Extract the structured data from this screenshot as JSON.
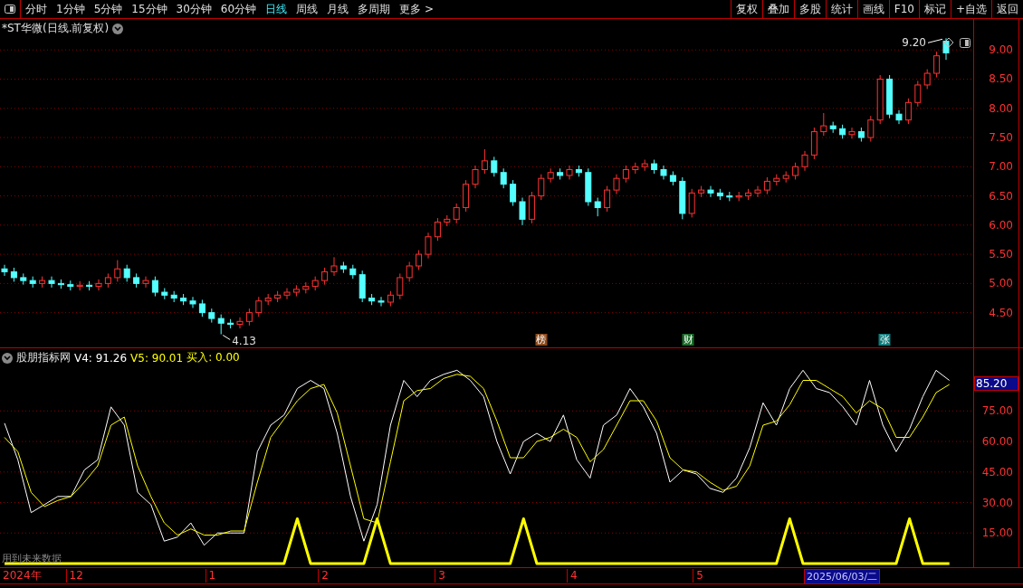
{
  "toolbar": {
    "periods": [
      {
        "label": "分时",
        "selected": false
      },
      {
        "label": "1分钟",
        "selected": false
      },
      {
        "label": "5分钟",
        "selected": false
      },
      {
        "label": "15分钟",
        "selected": false
      },
      {
        "label": "30分钟",
        "selected": false
      },
      {
        "label": "60分钟",
        "selected": false
      },
      {
        "label": "日线",
        "selected": true
      },
      {
        "label": "周线",
        "selected": false
      },
      {
        "label": "月线",
        "selected": false
      },
      {
        "label": "多周期",
        "selected": false
      },
      {
        "label": "更多 >",
        "selected": false
      }
    ],
    "actions": [
      "复权",
      "叠加",
      "多股",
      "统计",
      "画线",
      "F10",
      "标记",
      "+自选",
      "返回"
    ]
  },
  "price_pane": {
    "title": "*ST华微(日线.前复权)",
    "chart_data": {
      "type": "candlestick",
      "grid": true,
      "ohlc": [
        [
          5.25,
          5.32,
          5.13,
          5.2
        ],
        [
          5.2,
          5.27,
          5.03,
          5.1
        ],
        [
          5.1,
          5.17,
          4.98,
          5.05
        ],
        [
          5.05,
          5.12,
          4.93,
          5.0
        ],
        [
          5.0,
          5.12,
          4.93,
          5.05
        ],
        [
          5.05,
          5.12,
          4.93,
          5.0
        ],
        [
          5.0,
          5.07,
          4.91,
          4.98
        ],
        [
          4.98,
          5.05,
          4.88,
          4.95
        ],
        [
          4.95,
          5.04,
          4.88,
          4.97
        ],
        [
          4.97,
          5.04,
          4.88,
          4.95
        ],
        [
          4.95,
          5.07,
          4.88,
          5.0
        ],
        [
          5.0,
          5.17,
          4.93,
          5.1
        ],
        [
          5.1,
          5.4,
          5.03,
          5.25
        ],
        [
          5.25,
          5.32,
          5.03,
          5.1
        ],
        [
          5.1,
          5.17,
          4.93,
          5.0
        ],
        [
          5.0,
          5.12,
          4.93,
          5.05
        ],
        [
          5.05,
          5.12,
          4.78,
          4.85
        ],
        [
          4.85,
          4.92,
          4.73,
          4.8
        ],
        [
          4.8,
          4.87,
          4.68,
          4.75
        ],
        [
          4.75,
          4.82,
          4.63,
          4.7
        ],
        [
          4.7,
          4.77,
          4.58,
          4.65
        ],
        [
          4.65,
          4.72,
          4.43,
          4.5
        ],
        [
          4.5,
          4.57,
          4.33,
          4.4
        ],
        [
          4.4,
          4.47,
          4.13,
          4.32
        ],
        [
          4.32,
          4.39,
          4.23,
          4.3
        ],
        [
          4.3,
          4.42,
          4.23,
          4.35
        ],
        [
          4.35,
          4.57,
          4.28,
          4.5
        ],
        [
          4.5,
          4.77,
          4.43,
          4.7
        ],
        [
          4.7,
          4.82,
          4.63,
          4.75
        ],
        [
          4.75,
          4.87,
          4.68,
          4.8
        ],
        [
          4.8,
          4.92,
          4.73,
          4.85
        ],
        [
          4.85,
          4.97,
          4.78,
          4.9
        ],
        [
          4.9,
          5.02,
          4.83,
          4.95
        ],
        [
          4.95,
          5.12,
          4.88,
          5.05
        ],
        [
          5.05,
          5.27,
          4.98,
          5.2
        ],
        [
          5.2,
          5.45,
          5.13,
          5.3
        ],
        [
          5.3,
          5.37,
          5.18,
          5.25
        ],
        [
          5.25,
          5.32,
          5.08,
          5.15
        ],
        [
          5.15,
          5.22,
          4.68,
          4.75
        ],
        [
          4.75,
          4.82,
          4.63,
          4.7
        ],
        [
          4.7,
          4.77,
          4.61,
          4.68
        ],
        [
          4.68,
          4.87,
          4.61,
          4.8
        ],
        [
          4.8,
          5.17,
          4.73,
          5.1
        ],
        [
          5.1,
          5.37,
          5.03,
          5.3
        ],
        [
          5.3,
          5.57,
          5.23,
          5.5
        ],
        [
          5.5,
          5.87,
          5.43,
          5.8
        ],
        [
          5.8,
          6.12,
          5.73,
          6.05
        ],
        [
          6.05,
          6.17,
          5.98,
          6.1
        ],
        [
          6.1,
          6.37,
          6.03,
          6.3
        ],
        [
          6.3,
          6.77,
          6.23,
          6.7
        ],
        [
          6.7,
          7.02,
          6.63,
          6.95
        ],
        [
          6.95,
          7.3,
          6.88,
          7.1
        ],
        [
          7.1,
          7.17,
          6.83,
          6.9
        ],
        [
          6.9,
          6.97,
          6.63,
          6.7
        ],
        [
          6.7,
          6.77,
          6.33,
          6.4
        ],
        [
          6.4,
          6.47,
          6.0,
          6.1
        ],
        [
          6.1,
          6.57,
          6.03,
          6.5
        ],
        [
          6.5,
          6.87,
          6.43,
          6.8
        ],
        [
          6.8,
          6.97,
          6.73,
          6.9
        ],
        [
          6.9,
          6.97,
          6.78,
          6.85
        ],
        [
          6.85,
          7.02,
          6.78,
          6.95
        ],
        [
          6.95,
          7.02,
          6.83,
          6.9
        ],
        [
          6.9,
          6.97,
          6.33,
          6.4
        ],
        [
          6.4,
          6.47,
          6.15,
          6.3
        ],
        [
          6.3,
          6.67,
          6.23,
          6.6
        ],
        [
          6.6,
          6.87,
          6.53,
          6.8
        ],
        [
          6.8,
          7.02,
          6.73,
          6.95
        ],
        [
          6.95,
          7.07,
          6.88,
          7.0
        ],
        [
          7.0,
          7.12,
          6.93,
          7.05
        ],
        [
          7.05,
          7.12,
          6.88,
          6.95
        ],
        [
          6.95,
          7.02,
          6.78,
          6.85
        ],
        [
          6.85,
          6.92,
          6.68,
          6.75
        ],
        [
          6.75,
          6.82,
          6.1,
          6.2
        ],
        [
          6.2,
          6.62,
          6.13,
          6.55
        ],
        [
          6.55,
          6.67,
          6.48,
          6.6
        ],
        [
          6.6,
          6.67,
          6.48,
          6.55
        ],
        [
          6.55,
          6.62,
          6.43,
          6.5
        ],
        [
          6.5,
          6.57,
          6.41,
          6.48
        ],
        [
          6.48,
          6.57,
          6.41,
          6.5
        ],
        [
          6.5,
          6.62,
          6.43,
          6.55
        ],
        [
          6.55,
          6.67,
          6.48,
          6.6
        ],
        [
          6.6,
          6.82,
          6.53,
          6.75
        ],
        [
          6.75,
          6.87,
          6.68,
          6.8
        ],
        [
          6.8,
          6.92,
          6.73,
          6.85
        ],
        [
          6.85,
          7.07,
          6.78,
          7.0
        ],
        [
          7.0,
          7.27,
          6.93,
          7.2
        ],
        [
          7.2,
          7.67,
          7.13,
          7.6
        ],
        [
          7.6,
          7.92,
          7.53,
          7.7
        ],
        [
          7.7,
          7.77,
          7.58,
          7.65
        ],
        [
          7.65,
          7.72,
          7.48,
          7.55
        ],
        [
          7.55,
          7.67,
          7.48,
          7.6
        ],
        [
          7.6,
          7.67,
          7.43,
          7.5
        ],
        [
          7.5,
          7.87,
          7.43,
          7.8
        ],
        [
          7.8,
          8.57,
          7.73,
          8.5
        ],
        [
          8.5,
          8.57,
          7.83,
          7.9
        ],
        [
          7.9,
          7.97,
          7.73,
          7.8
        ],
        [
          7.8,
          8.17,
          7.73,
          8.1
        ],
        [
          8.1,
          8.47,
          8.03,
          8.4
        ],
        [
          8.4,
          8.67,
          8.33,
          8.6
        ],
        [
          8.6,
          8.97,
          8.53,
          8.9
        ],
        [
          9.15,
          9.2,
          8.83,
          8.95
        ]
      ],
      "ylim": [
        3.89,
        9.53
      ],
      "yticks": [
        {
          "value": 9.0,
          "label": "9.00"
        },
        {
          "value": 8.5,
          "label": "8.50"
        },
        {
          "value": 8.0,
          "label": "8.00"
        },
        {
          "value": 7.5,
          "label": "7.50"
        },
        {
          "value": 7.0,
          "label": "7.00"
        },
        {
          "value": 6.5,
          "label": "6.50"
        },
        {
          "value": 6.0,
          "label": "6.00"
        },
        {
          "value": 5.5,
          "label": "5.50"
        },
        {
          "value": 5.0,
          "label": "5.00"
        },
        {
          "value": 4.5,
          "label": "4.50"
        }
      ],
      "annotations": [
        "4.13",
        "9.20"
      ]
    },
    "markers": [
      {
        "label": "榜",
        "color": "#8b4a1c"
      },
      {
        "label": "财",
        "color": "#1c6b2a"
      },
      {
        "label": "张",
        "color": "#0f7a7a"
      }
    ]
  },
  "indicator_pane": {
    "name": "股朋指标网",
    "readings": [
      {
        "label": "V4: 91.26",
        "color": "#ffffff"
      },
      {
        "label": "V5: 90.01",
        "color": "#ffff00"
      },
      {
        "label": "买入: 0.00",
        "color": "#ffff00"
      }
    ],
    "current_value": "85.20",
    "note": "用到未来数据",
    "chart_data": {
      "type": "line",
      "grid": true,
      "ylim": [
        -2.23,
        105.8
      ],
      "yticks": [
        {
          "value": 75,
          "label": "75.00"
        },
        {
          "value": 60,
          "label": "60.00"
        },
        {
          "value": 45,
          "label": "45.00"
        },
        {
          "value": 30,
          "label": "30.00"
        },
        {
          "value": 15,
          "label": "15.00"
        }
      ],
      "series": [
        {
          "color": "#ffffff",
          "values": [
            69,
            51,
            25,
            29,
            33,
            33,
            46,
            51,
            77,
            68,
            35,
            29,
            11,
            13,
            20,
            9,
            15,
            15,
            15,
            55,
            68,
            73,
            86,
            90,
            86,
            64,
            33,
            11,
            29,
            68,
            90,
            82,
            90,
            93,
            95,
            90,
            82,
            60,
            44,
            60,
            64,
            60,
            73,
            51,
            42,
            68,
            73,
            86,
            77,
            64,
            40,
            46,
            44,
            37,
            35,
            42,
            57,
            79,
            68,
            86,
            95,
            86,
            84,
            77,
            68,
            90,
            68,
            55,
            66,
            82,
            95,
            90
          ]
        },
        {
          "color": "#ffff00",
          "values": [
            62,
            55,
            35,
            28,
            31,
            33,
            40,
            48,
            68,
            72,
            48,
            33,
            20,
            14,
            17,
            14,
            14,
            16,
            16,
            40,
            62,
            71,
            80,
            86,
            88,
            74,
            48,
            22,
            20,
            50,
            80,
            85,
            86,
            91,
            93,
            92,
            86,
            70,
            52,
            52,
            60,
            62,
            66,
            62,
            50,
            56,
            68,
            80,
            80,
            70,
            52,
            46,
            45,
            40,
            36,
            38,
            48,
            68,
            70,
            78,
            90,
            90,
            86,
            82,
            74,
            80,
            76,
            62,
            62,
            72,
            84,
            88
          ]
        },
        {
          "color": "#ffff00",
          "values": [
            0,
            0,
            0,
            0,
            0,
            0,
            0,
            0,
            0,
            0,
            0,
            0,
            0,
            0,
            0,
            0,
            0,
            0,
            0,
            0,
            0,
            0,
            22,
            0,
            0,
            0,
            0,
            0,
            22,
            0,
            0,
            0,
            0,
            0,
            0,
            0,
            0,
            0,
            0,
            22,
            0,
            0,
            0,
            0,
            0,
            0,
            0,
            0,
            0,
            0,
            0,
            0,
            0,
            0,
            0,
            0,
            0,
            0,
            0,
            22,
            0,
            0,
            0,
            0,
            0,
            0,
            0,
            0,
            22,
            0,
            0,
            0
          ]
        }
      ]
    }
  },
  "x_axis": {
    "year": "2024年",
    "months": [
      "12",
      "1",
      "2",
      "3",
      "4",
      "5"
    ],
    "cursor_date": "2025/06/03/二"
  }
}
